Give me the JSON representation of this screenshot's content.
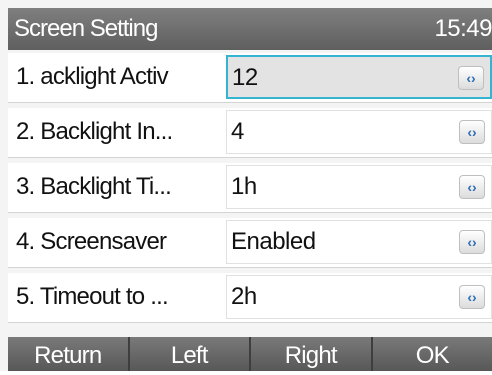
{
  "header": {
    "title": "Screen Setting",
    "time": "15:49"
  },
  "settings": [
    {
      "label": "1.  acklight Activ",
      "value": "12",
      "control": "‹›",
      "active": true
    },
    {
      "label": "2.  Backlight In...",
      "value": "4",
      "control": "‹›",
      "active": false
    },
    {
      "label": "3.  Backlight Ti...",
      "value": "1h",
      "control": "‹›",
      "active": false
    },
    {
      "label": "4.  Screensaver",
      "value": "Enabled",
      "control": "‹›",
      "active": false
    },
    {
      "label": "5.  Timeout to ...",
      "value": "2h",
      "control": "‹›",
      "active": false
    }
  ],
  "softkeys": {
    "return": "Return",
    "left": "Left",
    "right": "Right",
    "ok": "OK"
  },
  "colors": {
    "titlebar": "#6f6f6f",
    "focus_border": "#35b4d2",
    "arrow": "#2b6db5",
    "softkey": "#6a6a6a"
  }
}
